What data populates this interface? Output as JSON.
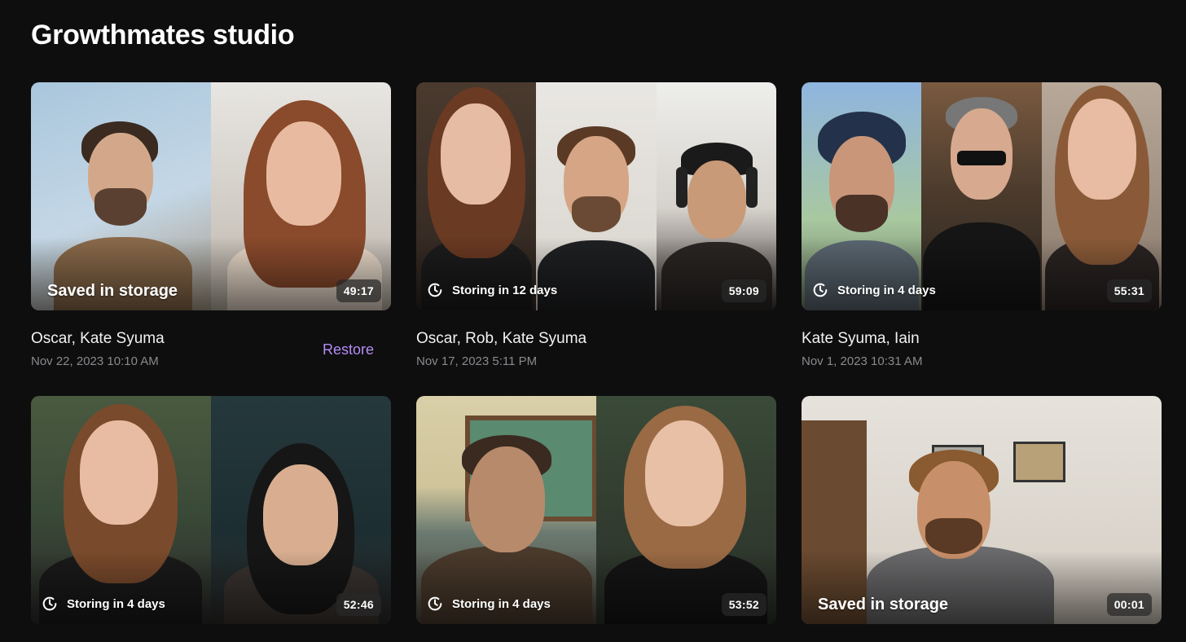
{
  "studio": {
    "title": "Growthmates studio"
  },
  "recordings": [
    {
      "status": "Saved in storage",
      "saved": true,
      "duration": "49:17",
      "participants": "Oscar, Kate Syuma",
      "date": "Nov 22, 2023 10:10 AM",
      "action": "Restore"
    },
    {
      "status": "Storing in 12 days",
      "saved": false,
      "duration": "59:09",
      "participants": "Oscar, Rob, Kate Syuma",
      "date": "Nov 17, 2023 5:11 PM"
    },
    {
      "status": "Storing in 4 days",
      "saved": false,
      "duration": "55:31",
      "participants": "Kate Syuma, Iain",
      "date": "Nov 1, 2023 10:31 AM"
    },
    {
      "status": "Storing in 4 days",
      "saved": false,
      "duration": "52:46"
    },
    {
      "status": "Storing in 4 days",
      "saved": false,
      "duration": "53:52"
    },
    {
      "status": "Saved in storage",
      "saved": true,
      "duration": "00:01"
    }
  ],
  "icons": {
    "storing": "clock-refresh-icon"
  },
  "colors": {
    "background": "#0e0e0f",
    "accent": "#b58cf5",
    "muted": "#8a8a8e"
  }
}
